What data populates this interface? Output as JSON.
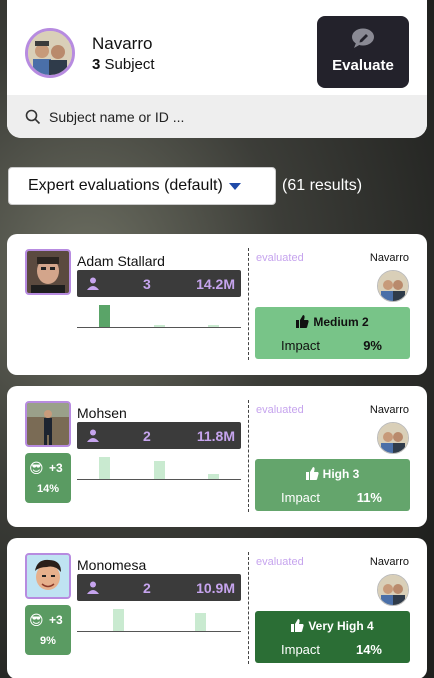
{
  "header": {
    "name": "Navarro",
    "subject_count": "3",
    "subject_label": "Subject",
    "evaluate_label": "Evaluate"
  },
  "search": {
    "placeholder": "Subject name or ID ..."
  },
  "filter": {
    "selected": "Expert evaluations (default)",
    "results": "(61 results)"
  },
  "cards": [
    {
      "name": "Adam Stallard",
      "count": "3",
      "size": "14.2M",
      "bars": [
        0.85,
        0.08,
        0.08
      ],
      "evaluated_label": "evaluated",
      "evaluator": "Navarro",
      "verdict": "Medium 2",
      "impact_label": "Impact",
      "impact": "9%",
      "badge": null
    },
    {
      "name": "Mohsen",
      "count": "2",
      "size": "11.8M",
      "bars": [
        0.85,
        0.7,
        0.18
      ],
      "evaluated_label": "evaluated",
      "evaluator": "Navarro",
      "verdict": "High 3",
      "impact_label": "Impact",
      "impact": "11%",
      "badge": {
        "emoji": "😎",
        "plus": "+3",
        "pct": "14%"
      }
    },
    {
      "name": "Monomesa",
      "count": "2",
      "size": "10.9M",
      "bars": [
        0.85,
        0.0,
        0.7
      ],
      "evaluated_label": "evaluated",
      "evaluator": "Navarro",
      "verdict": "Very High 4",
      "impact_label": "Impact",
      "impact": "14%",
      "badge": {
        "emoji": "😎",
        "plus": "+3",
        "pct": "9%"
      }
    }
  ],
  "colors": {
    "accent_purple": "#c6a4ee",
    "medium_green": "#78c488",
    "high_green": "#64a56c",
    "very_high_green": "#2b6e35",
    "dark_button": "#23222b"
  }
}
